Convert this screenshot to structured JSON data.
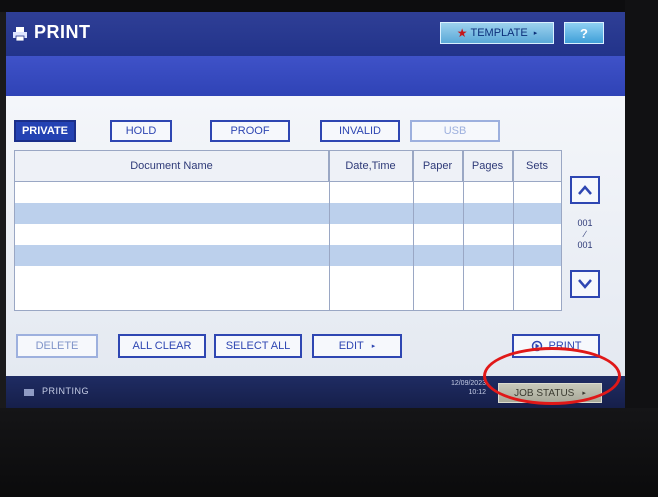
{
  "header": {
    "title": "PRINT",
    "template_label": "TEMPLATE",
    "help_label": "?"
  },
  "tabs": [
    {
      "label": "PRIVATE"
    },
    {
      "label": "HOLD"
    },
    {
      "label": "PROOF"
    },
    {
      "label": "INVALID"
    },
    {
      "label": "USB"
    }
  ],
  "table": {
    "columns": [
      "Document Name",
      "Date,Time",
      "Paper",
      "Pages",
      "Sets"
    ],
    "rows": []
  },
  "pagination": {
    "current": "001",
    "total": "001"
  },
  "actions": {
    "delete_label": "DELETE",
    "all_clear_label": "ALL CLEAR",
    "select_all_label": "SELECT ALL",
    "edit_label": "EDIT",
    "print_label": "PRINT"
  },
  "status": {
    "text": "PRINTING",
    "date": "12/09/2023",
    "time": "10:12",
    "job_status_label": "JOB STATUS"
  },
  "colors": {
    "title_bar": "#22338a",
    "accent_blue": "#2e46b2",
    "row_highlight": "#bcd0ec",
    "annotation": "#e01818"
  }
}
